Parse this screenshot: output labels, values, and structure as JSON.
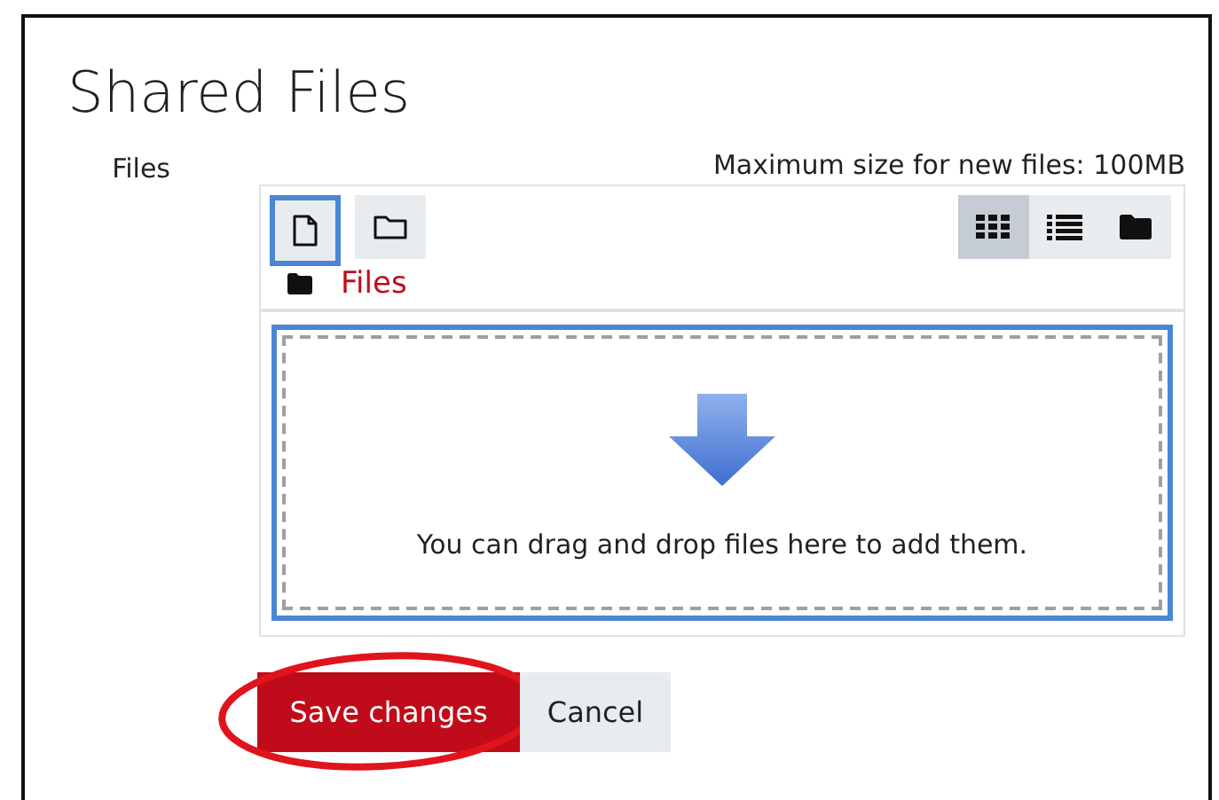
{
  "page_title": "Shared Files",
  "field_label": "Files",
  "max_size": "Maximum size for new files: 100MB",
  "toolbar": [
    {
      "kind": "file",
      "selected": true
    },
    {
      "kind": "folder",
      "selected": false
    }
  ],
  "view_modes": [
    {
      "kind": "grid",
      "selected": true
    },
    {
      "kind": "list",
      "selected": false
    },
    {
      "kind": "tree",
      "selected": false
    }
  ],
  "breadcrumb": "Files",
  "drop_hint": "You can drag and drop files here to add them.",
  "buttons": [
    {
      "label": "Save changes",
      "kind": "primary",
      "highlighted": true
    },
    {
      "label": "Cancel",
      "kind": "secondary",
      "highlighted": false
    }
  ]
}
